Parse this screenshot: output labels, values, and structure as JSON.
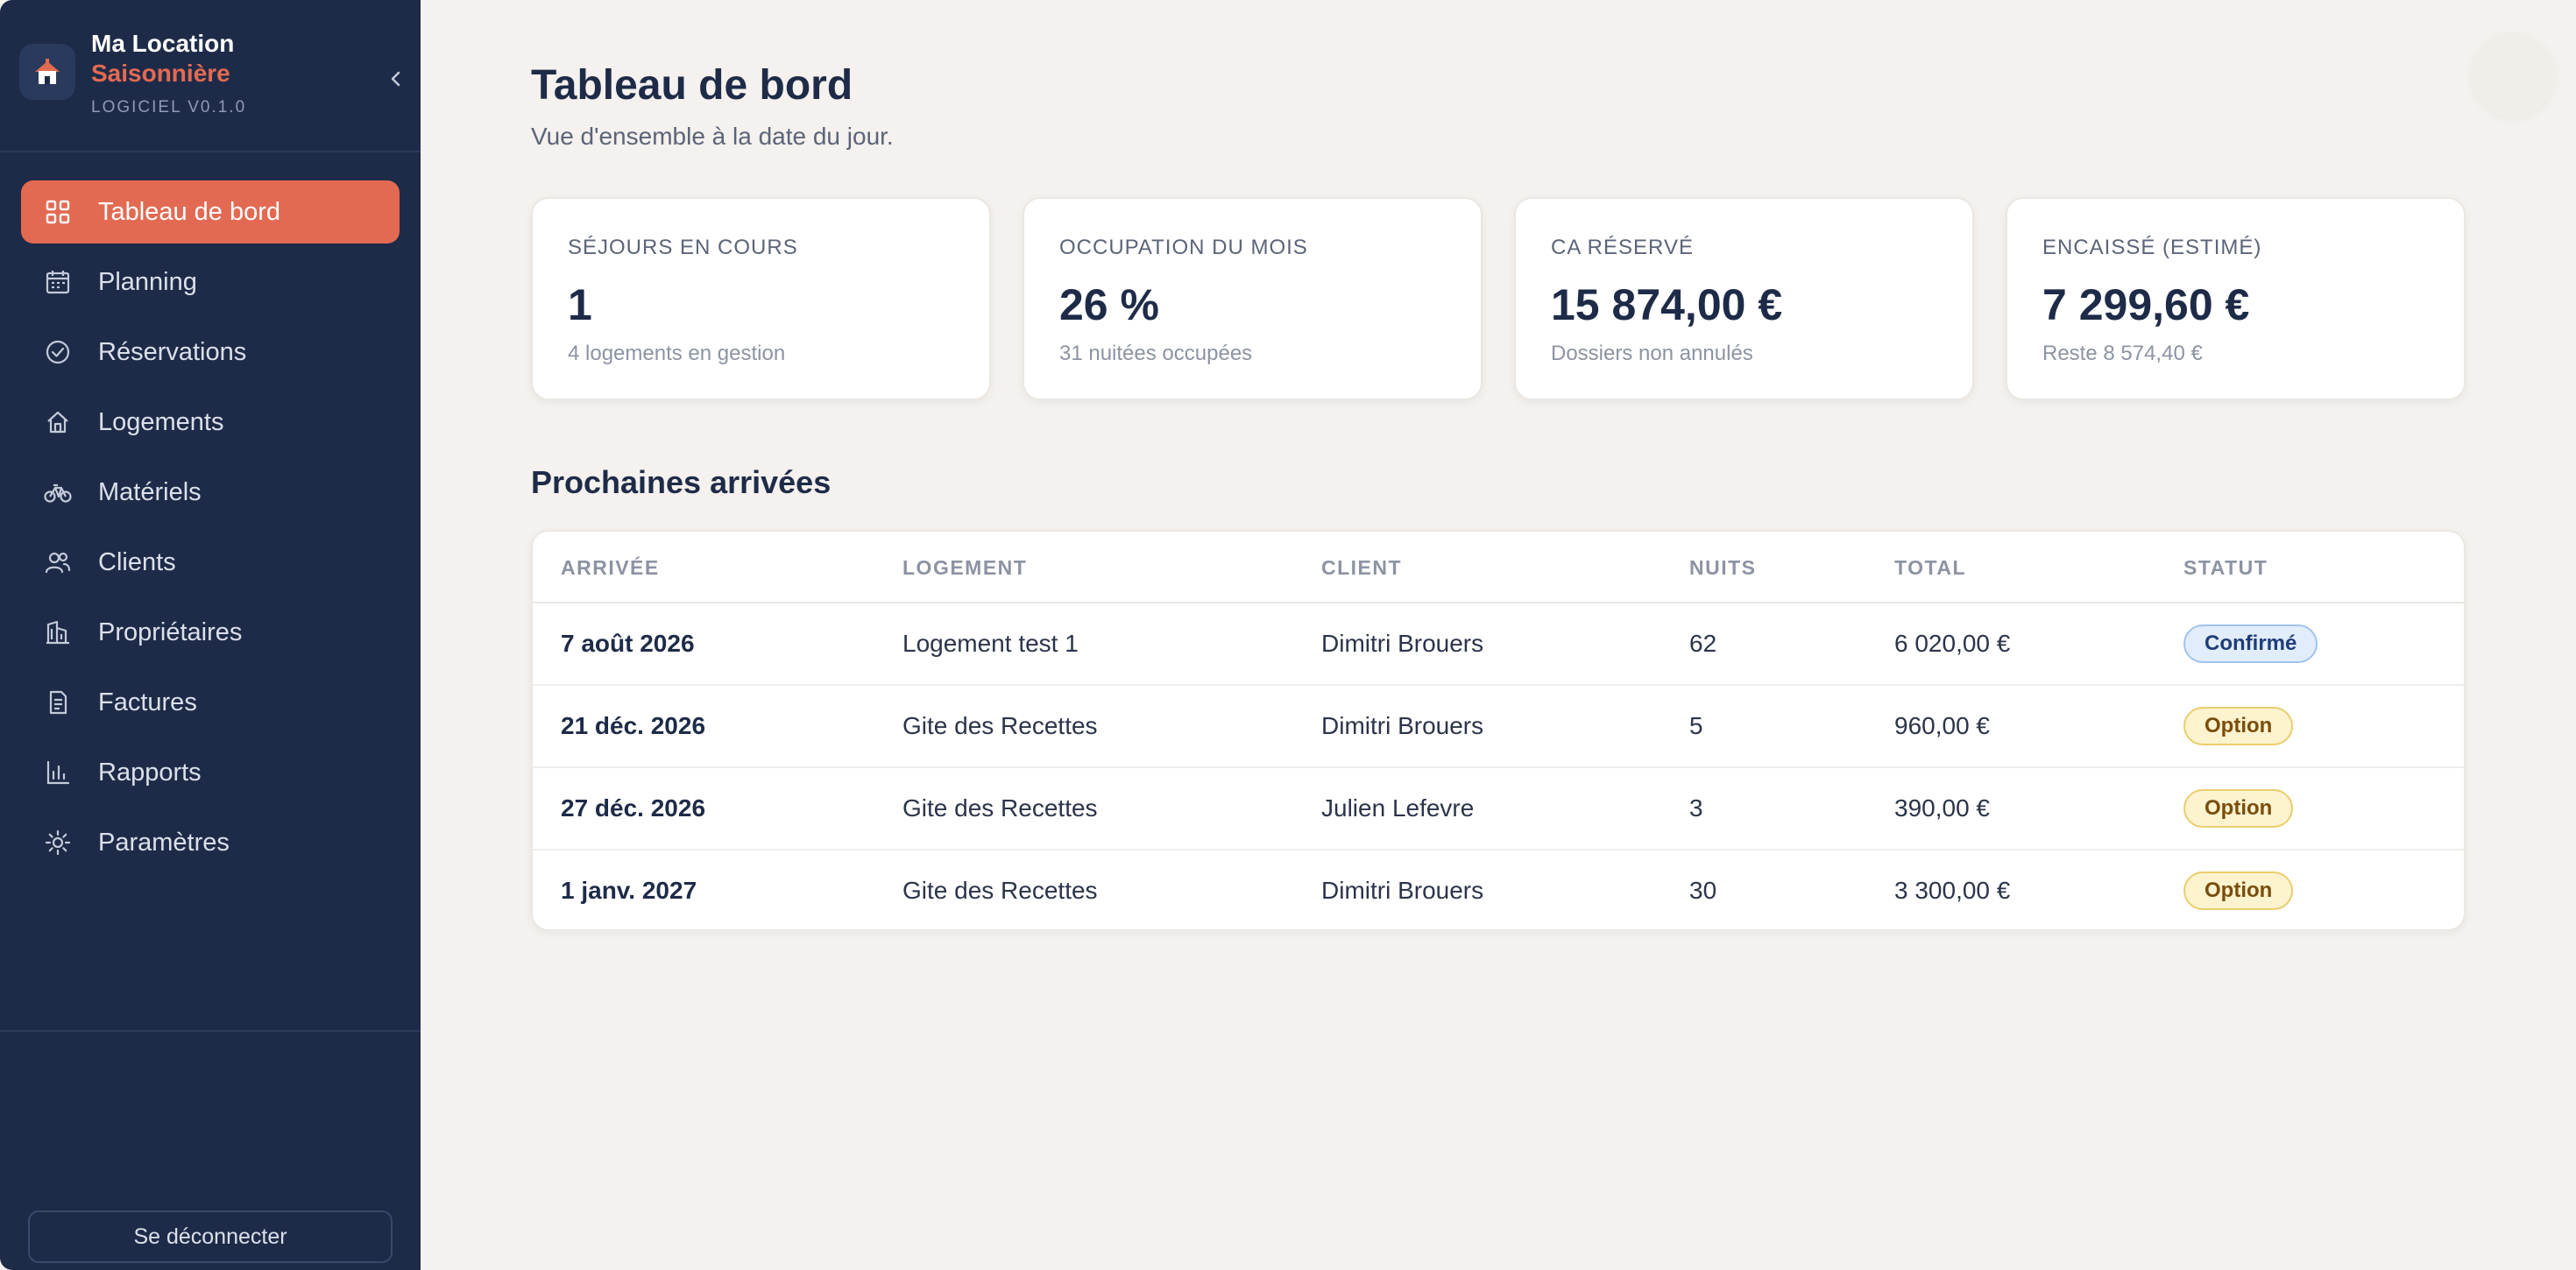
{
  "brand": {
    "name_line1": "Ma Location",
    "name_line2": "Saisonnière",
    "version": "LOGICIEL V0.1.0"
  },
  "sidebar": {
    "items": [
      {
        "label": "Tableau de bord",
        "icon": "dashboard-grid-icon",
        "active": true
      },
      {
        "label": "Planning",
        "icon": "calendar-icon",
        "active": false
      },
      {
        "label": "Réservations",
        "icon": "check-circle-icon",
        "active": false
      },
      {
        "label": "Logements",
        "icon": "house-icon",
        "active": false
      },
      {
        "label": "Matériels",
        "icon": "bicycle-icon",
        "active": false
      },
      {
        "label": "Clients",
        "icon": "users-icon",
        "active": false
      },
      {
        "label": "Propriétaires",
        "icon": "building-icon",
        "active": false
      },
      {
        "label": "Factures",
        "icon": "document-icon",
        "active": false
      },
      {
        "label": "Rapports",
        "icon": "bar-chart-icon",
        "active": false
      },
      {
        "label": "Paramètres",
        "icon": "sun-settings-icon",
        "active": false
      }
    ],
    "logout_label": "Se déconnecter"
  },
  "header": {
    "title": "Tableau de bord",
    "subtitle": "Vue d'ensemble à la date du jour."
  },
  "stats": [
    {
      "label": "SÉJOURS EN COURS",
      "value": "1",
      "sub": "4 logements en gestion"
    },
    {
      "label": "OCCUPATION DU MOIS",
      "value": "26 %",
      "sub": "31 nuitées occupées"
    },
    {
      "label": "CA RÉSERVÉ",
      "value": "15 874,00 €",
      "sub": "Dossiers non annulés"
    },
    {
      "label": "ENCAISSÉ (ESTIMÉ)",
      "value": "7 299,60 €",
      "sub": "Reste 8 574,40 €"
    }
  ],
  "arrivals": {
    "title": "Prochaines arrivées",
    "columns": [
      "ARRIVÉE",
      "LOGEMENT",
      "CLIENT",
      "NUITS",
      "TOTAL",
      "STATUT"
    ],
    "rows": [
      {
        "date": "7 août 2026",
        "logement": "Logement test 1",
        "client": "Dimitri Brouers",
        "nuits": "62",
        "total": "6 020,00 €",
        "statut": "Confirmé",
        "statut_type": "confirmed"
      },
      {
        "date": "21 déc. 2026",
        "logement": "Gite des Recettes",
        "client": "Dimitri Brouers",
        "nuits": "5",
        "total": "960,00 €",
        "statut": "Option",
        "statut_type": "option"
      },
      {
        "date": "27 déc. 2026",
        "logement": "Gite des Recettes",
        "client": "Julien Lefevre",
        "nuits": "3",
        "total": "390,00 €",
        "statut": "Option",
        "statut_type": "option"
      },
      {
        "date": "1 janv. 2027",
        "logement": "Gite des Recettes",
        "client": "Dimitri Brouers",
        "nuits": "30",
        "total": "3 300,00 €",
        "statut": "Option",
        "statut_type": "option"
      }
    ]
  },
  "colors": {
    "sidebar_bg": "#1e2b48",
    "accent": "#e36a52",
    "page_bg": "#f4f1ee"
  }
}
